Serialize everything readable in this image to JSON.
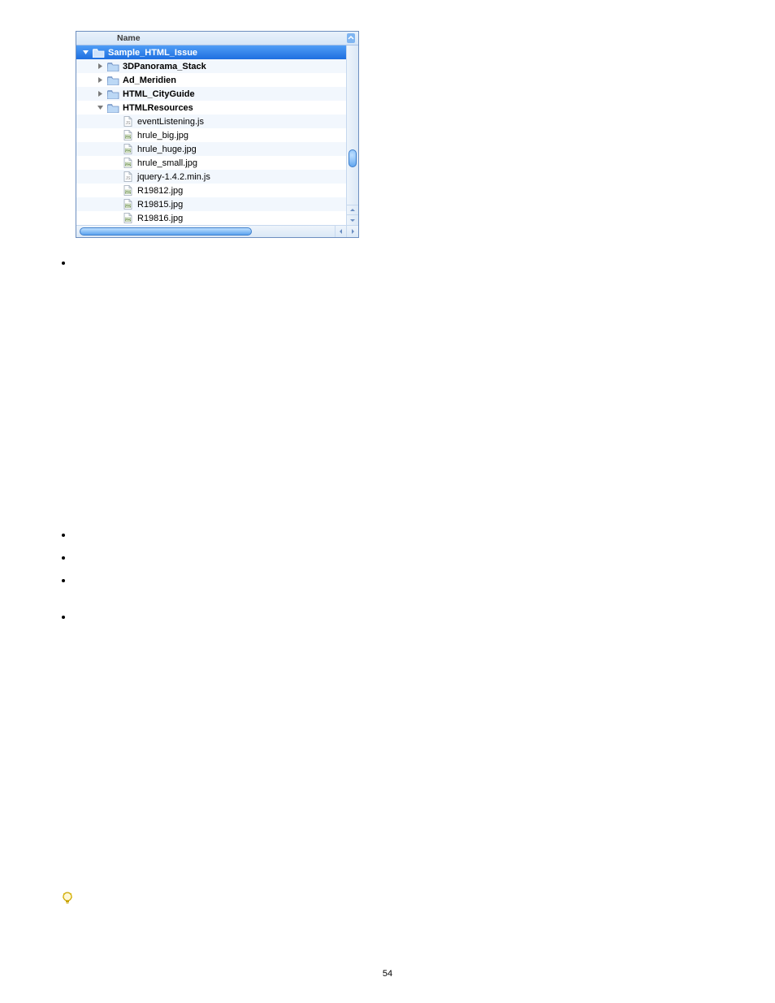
{
  "column_header": "Name",
  "tree": [
    {
      "indent": 0,
      "expanded": true,
      "kind": "folder",
      "label": "Sample_HTML_Issue",
      "selected": true
    },
    {
      "indent": 1,
      "expanded": false,
      "kind": "folder",
      "label": "3DPanorama_Stack"
    },
    {
      "indent": 1,
      "expanded": false,
      "kind": "folder",
      "label": "Ad_Meridien"
    },
    {
      "indent": 1,
      "expanded": false,
      "kind": "folder",
      "label": "HTML_CityGuide"
    },
    {
      "indent": 1,
      "expanded": true,
      "kind": "folder",
      "label": "HTMLResources"
    },
    {
      "indent": 2,
      "expanded": null,
      "kind": "file-js",
      "label": "eventListening.js"
    },
    {
      "indent": 2,
      "expanded": null,
      "kind": "file-img",
      "label": "hrule_big.jpg"
    },
    {
      "indent": 2,
      "expanded": null,
      "kind": "file-img",
      "label": "hrule_huge.jpg"
    },
    {
      "indent": 2,
      "expanded": null,
      "kind": "file-img",
      "label": "hrule_small.jpg"
    },
    {
      "indent": 2,
      "expanded": null,
      "kind": "file-js",
      "label": "jquery-1.4.2.min.js"
    },
    {
      "indent": 2,
      "expanded": null,
      "kind": "file-img",
      "label": "R19812.jpg"
    },
    {
      "indent": 2,
      "expanded": null,
      "kind": "file-img",
      "label": "R19815.jpg"
    },
    {
      "indent": 2,
      "expanded": null,
      "kind": "file-img",
      "label": "R19816.jpg"
    }
  ],
  "bullets_y": [
    322,
    657,
    685,
    713,
    758
  ],
  "page_number": "54"
}
